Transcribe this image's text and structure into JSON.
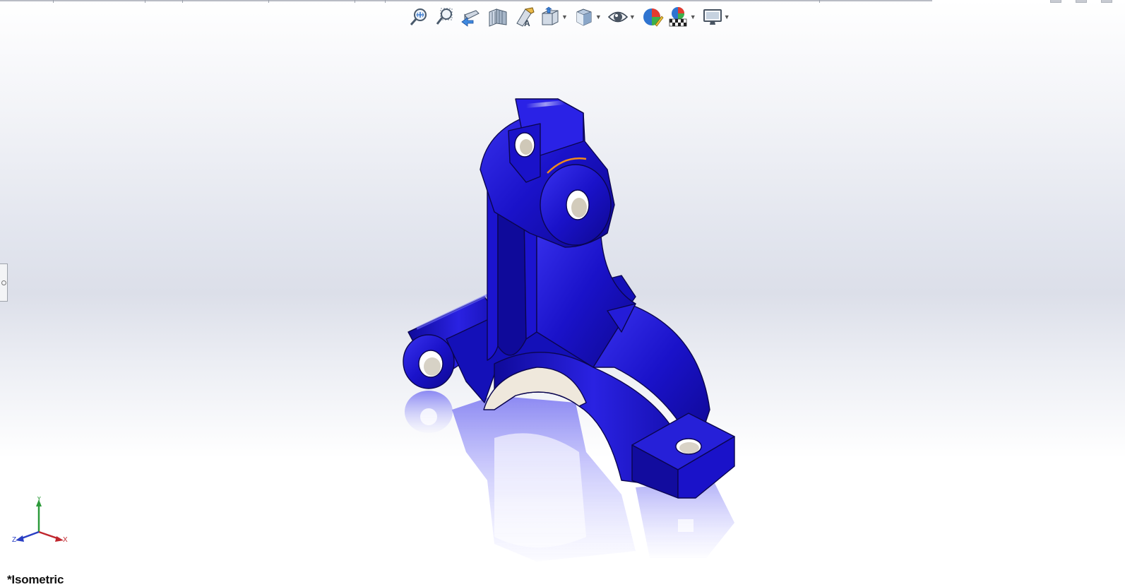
{
  "window": {
    "controls": [
      "minimize",
      "restore",
      "close"
    ]
  },
  "heads_up_toolbar": {
    "items": [
      {
        "icon": "zoom-to-fit-icon",
        "has_dropdown": false
      },
      {
        "icon": "zoom-to-area-icon",
        "has_dropdown": false
      },
      {
        "icon": "previous-view-icon",
        "has_dropdown": false
      },
      {
        "icon": "section-view-icon",
        "has_dropdown": false
      },
      {
        "icon": "dynamic-annotation-views-icon",
        "has_dropdown": false
      },
      {
        "icon": "view-orientation-icon",
        "has_dropdown": true
      },
      {
        "icon": "display-style-icon",
        "has_dropdown": true
      },
      {
        "icon": "hide-show-items-icon",
        "has_dropdown": true
      },
      {
        "icon": "edit-appearance-icon",
        "has_dropdown": false
      },
      {
        "icon": "apply-scene-icon",
        "has_dropdown": true
      },
      {
        "icon": "view-settings-icon",
        "has_dropdown": true
      }
    ]
  },
  "model": {
    "color": "#1a12c9",
    "edge_color": "#0b0650",
    "highlight_color": "#f08a1c"
  },
  "triad": {
    "x_label": "X",
    "y_label": "Y",
    "z_label": "Z",
    "x_color": "#c0262d",
    "y_color": "#2c9a3a",
    "z_color": "#2a3fc4"
  },
  "view": {
    "label": "*Isometric"
  }
}
